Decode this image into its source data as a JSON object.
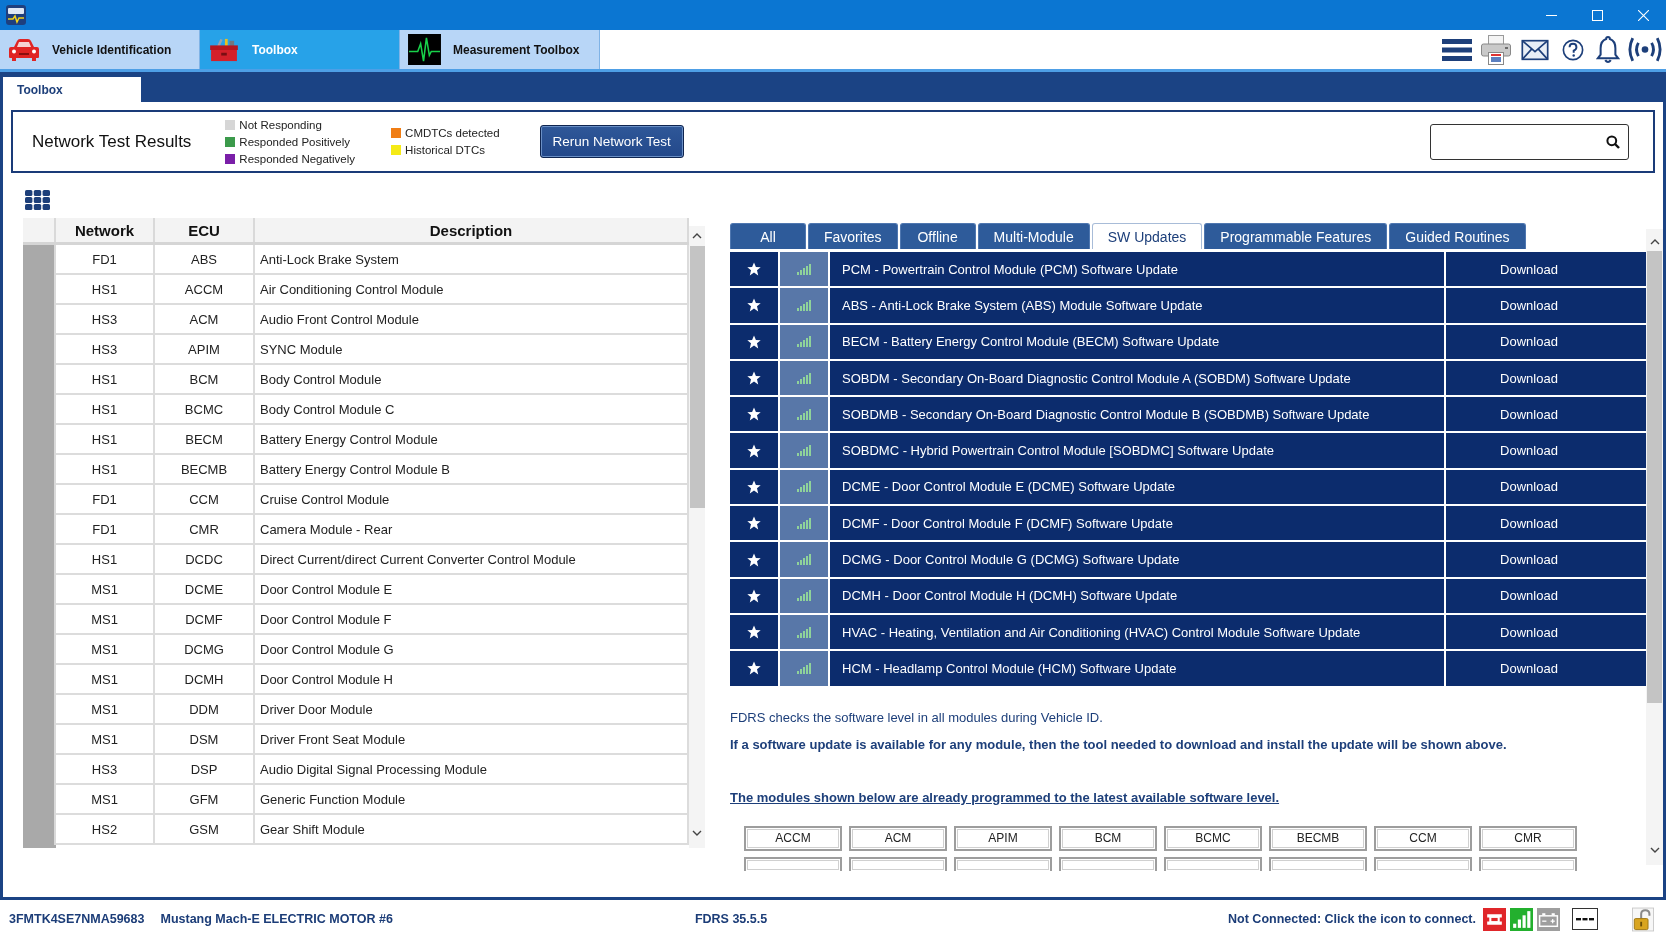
{
  "app_tabs": [
    {
      "label": "Vehicle Identification",
      "selected": false
    },
    {
      "label": "Toolbox",
      "selected": true
    },
    {
      "label": "Measurement Toolbox",
      "selected": false
    }
  ],
  "sub_tabs": [
    {
      "label": "Toolbox",
      "selected": true
    }
  ],
  "network_test": {
    "title": "Network Test Results",
    "legend_columns": [
      [
        {
          "label": "Not Responding",
          "color": "#d6d6d6"
        },
        {
          "label": "Responded Positively",
          "color": "#3b9a4b"
        },
        {
          "label": "Responded Negatively",
          "color": "#7a1fa8"
        }
      ],
      [
        {
          "label": "CMDTCs detected",
          "color": "#f07d14"
        },
        {
          "label": "Historical DTCs",
          "color": "#f5ea16"
        }
      ]
    ],
    "rerun_button": "Rerun Network Test"
  },
  "module_table": {
    "columns": [
      "Network",
      "ECU",
      "Description"
    ],
    "rows": [
      {
        "network": "FD1",
        "ecu": "ABS",
        "description": "Anti-Lock Brake System"
      },
      {
        "network": "HS1",
        "ecu": "ACCM",
        "description": "Air Conditioning Control Module"
      },
      {
        "network": "HS3",
        "ecu": "ACM",
        "description": "Audio Front Control Module"
      },
      {
        "network": "HS3",
        "ecu": "APIM",
        "description": "SYNC Module"
      },
      {
        "network": "HS1",
        "ecu": "BCM",
        "description": "Body Control Module"
      },
      {
        "network": "HS1",
        "ecu": "BCMC",
        "description": "Body Control Module C"
      },
      {
        "network": "HS1",
        "ecu": "BECM",
        "description": "Battery Energy Control Module"
      },
      {
        "network": "HS1",
        "ecu": "BECMB",
        "description": "Battery Energy Control Module B"
      },
      {
        "network": "FD1",
        "ecu": "CCM",
        "description": "Cruise Control Module"
      },
      {
        "network": "FD1",
        "ecu": "CMR",
        "description": "Camera Module - Rear"
      },
      {
        "network": "HS1",
        "ecu": "DCDC",
        "description": "Direct Current/direct Current Converter Control Module"
      },
      {
        "network": "MS1",
        "ecu": "DCME",
        "description": "Door Control Module E"
      },
      {
        "network": "MS1",
        "ecu": "DCMF",
        "description": "Door Control Module F"
      },
      {
        "network": "MS1",
        "ecu": "DCMG",
        "description": "Door Control Module G"
      },
      {
        "network": "MS1",
        "ecu": "DCMH",
        "description": "Door Control Module H"
      },
      {
        "network": "MS1",
        "ecu": "DDM",
        "description": "Driver Door Module"
      },
      {
        "network": "MS1",
        "ecu": "DSM",
        "description": "Driver Front Seat Module"
      },
      {
        "network": "HS3",
        "ecu": "DSP",
        "description": "Audio Digital Signal Processing Module"
      },
      {
        "network": "MS1",
        "ecu": "GFM",
        "description": "Generic Function Module"
      },
      {
        "network": "HS2",
        "ecu": "GSM",
        "description": "Gear Shift Module"
      }
    ]
  },
  "toolbox_tabs": [
    {
      "label": "All",
      "selected": false
    },
    {
      "label": "Favorites",
      "selected": false
    },
    {
      "label": "Offline",
      "selected": false
    },
    {
      "label": "Multi-Module",
      "selected": false
    },
    {
      "label": "SW Updates",
      "selected": true
    },
    {
      "label": "Programmable Features",
      "selected": false
    },
    {
      "label": "Guided Routines",
      "selected": false
    }
  ],
  "sw_updates": [
    {
      "title": "PCM - Powertrain Control Module (PCM) Software Update",
      "action": "Download"
    },
    {
      "title": "ABS - Anti-Lock Brake System (ABS) Module Software Update",
      "action": "Download"
    },
    {
      "title": "BECM - Battery Energy Control Module (BECM) Software Update",
      "action": "Download"
    },
    {
      "title": "SOBDM - Secondary On-Board Diagnostic Control Module A (SOBDM) Software Update",
      "action": "Download"
    },
    {
      "title": "SOBDMB - Secondary On-Board Diagnostic Control Module B (SOBDMB) Software Update",
      "action": "Download"
    },
    {
      "title": "SOBDMC - Hybrid Powertrain Control Module [SOBDMC] Software Update",
      "action": "Download"
    },
    {
      "title": "DCME - Door Control Module E (DCME) Software Update",
      "action": "Download"
    },
    {
      "title": "DCMF - Door Control Module F (DCMF) Software Update",
      "action": "Download"
    },
    {
      "title": "DCMG - Door Control Module G (DCMG) Software Update",
      "action": "Download"
    },
    {
      "title": "DCMH - Door Control Module H (DCMH) Software Update",
      "action": "Download"
    },
    {
      "title": "HVAC - Heating, Ventilation and Air Conditioning (HVAC) Control Module Software Update",
      "action": "Download"
    },
    {
      "title": "HCM - Headlamp Control Module (HCM) Software Update",
      "action": "Download"
    }
  ],
  "info": {
    "note": "FDRS checks the software level in all modules during Vehicle ID.",
    "notice": "If a software update is available for any module, then the tool needed to download and install the update will be shown above.",
    "programmed_heading": "The modules shown below are already programmed to the latest available software level."
  },
  "programmed_modules": [
    {
      "label": "ACCM",
      "cut": false
    },
    {
      "label": "ACM",
      "cut": false
    },
    {
      "label": "APIM",
      "cut": false
    },
    {
      "label": "BCM",
      "cut": false
    },
    {
      "label": "BCMC",
      "cut": false
    },
    {
      "label": "BECMB",
      "cut": false
    },
    {
      "label": "CCM",
      "cut": false
    },
    {
      "label": "CMR",
      "cut": false
    },
    {
      "cut": true
    },
    {
      "cut": true
    },
    {
      "cut": true
    },
    {
      "cut": true
    },
    {
      "cut": true
    },
    {
      "cut": true
    },
    {
      "cut": true
    },
    {
      "cut": true
    }
  ],
  "status_bar": {
    "vin": "3FMTK4SE7NMA59683",
    "vehicle": "Mustang Mach-E ELECTRIC MOTOR #6",
    "version": "FDRS 35.5.5",
    "connection": "Not Connected: Click the icon to connect."
  }
}
